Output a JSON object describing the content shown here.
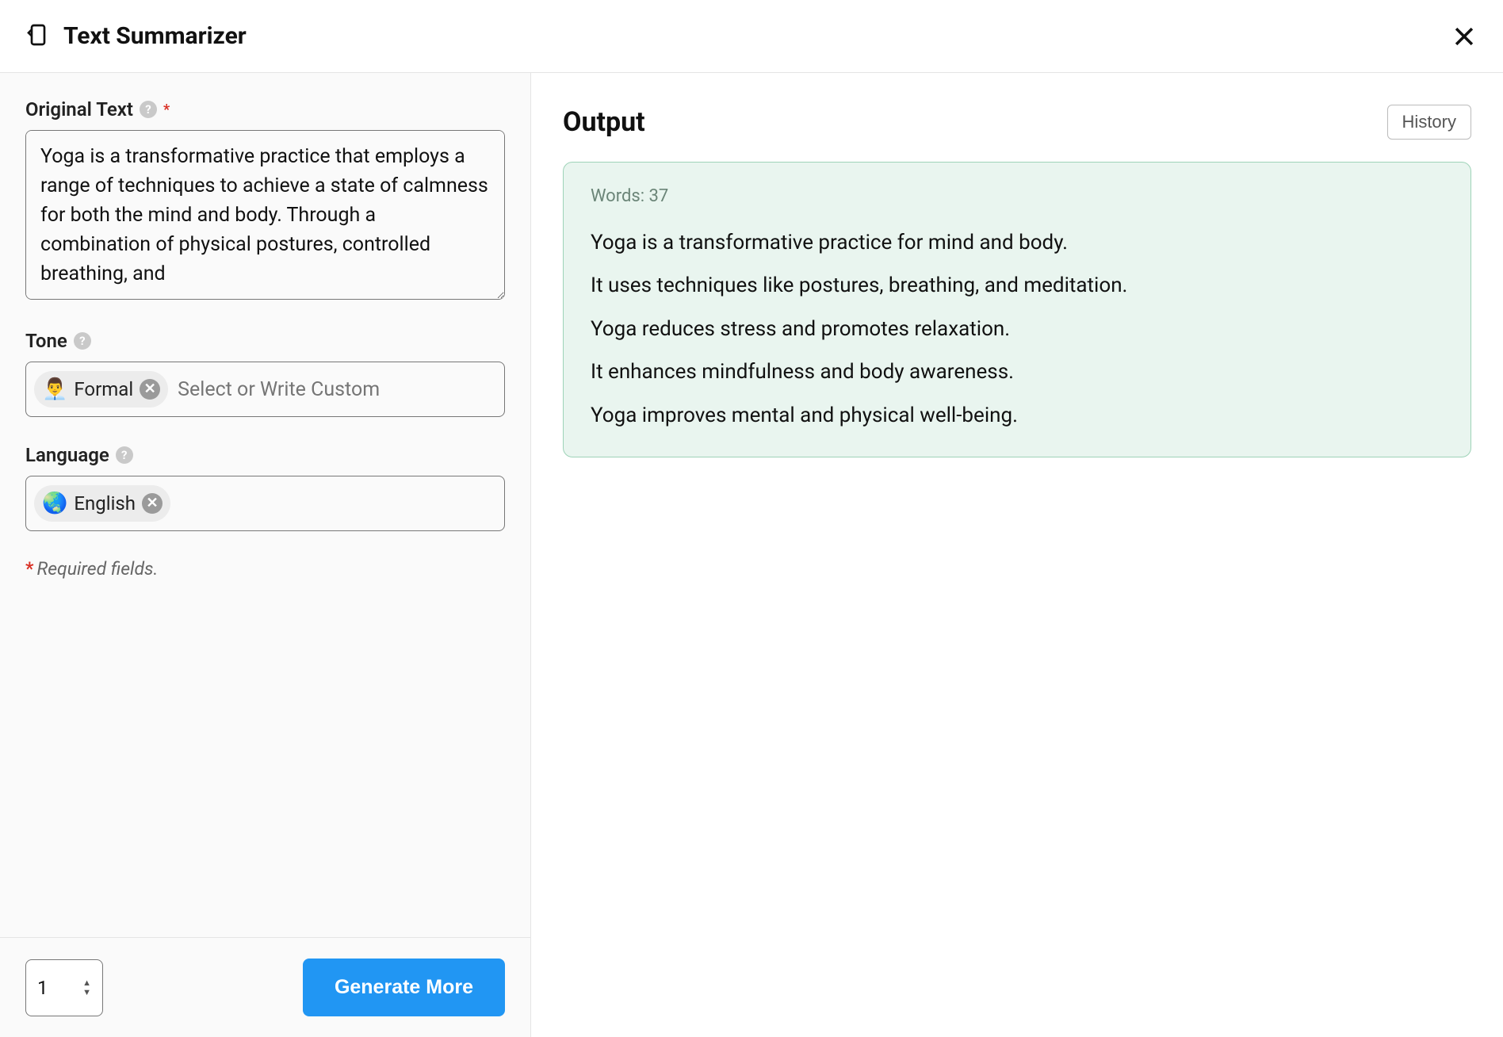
{
  "header": {
    "title": "Text Summarizer"
  },
  "form": {
    "original_text": {
      "label": "Original Text",
      "value": "Yoga is a transformative practice that employs a range of techniques to achieve a state of calmness for both the mind and body. Through a combination of physical postures, controlled breathing, and"
    },
    "tone": {
      "label": "Tone",
      "chip_emoji": "👨‍💼",
      "chip_label": "Formal",
      "placeholder": "Select or Write Custom"
    },
    "language": {
      "label": "Language",
      "chip_emoji": "🌏",
      "chip_label": "English"
    },
    "required_note": "Required fields."
  },
  "footer": {
    "count_value": "1",
    "generate_label": "Generate More"
  },
  "output": {
    "title": "Output",
    "history_label": "History",
    "word_count_label": "Words: 37",
    "lines": [
      "Yoga is a transformative practice for mind and body.",
      "It uses techniques like postures, breathing, and meditation.",
      "Yoga reduces stress and promotes relaxation.",
      "It enhances mindfulness and body awareness.",
      "Yoga improves mental and physical well-being."
    ]
  }
}
